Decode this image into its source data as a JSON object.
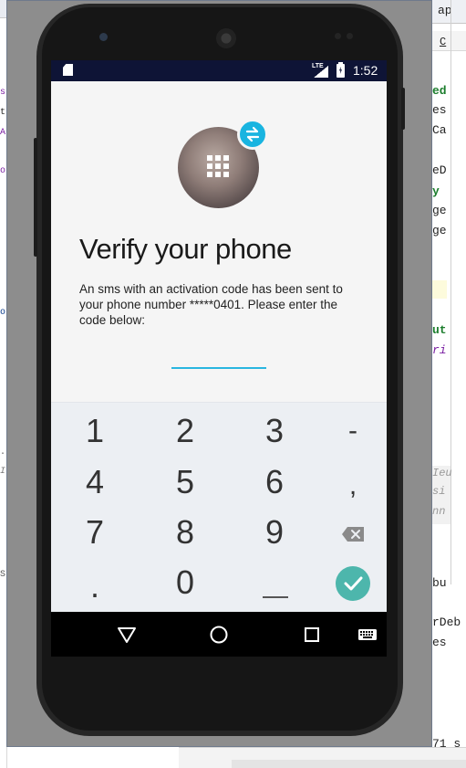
{
  "ide": {
    "left_code": [
      "s",
      "t",
      "A",
      "o",
      "o",
      ".",
      "I",
      "S"
    ],
    "right_top": "ap",
    "right_tab": "C",
    "right_code": [
      "ed",
      "es",
      "Ca",
      "eD",
      "y",
      "ge",
      "ge",
      "ut",
      "ri",
      "Ieu",
      "si",
      "nn",
      "bu",
      "rDeb",
      "es",
      "71 s"
    ]
  },
  "status_bar": {
    "network": "LTE",
    "time": "1:52"
  },
  "verify": {
    "title": "Verify your phone",
    "description_prefix": "An sms with an activation code has been sent to your phone number ",
    "phone_masked": "*****0401",
    "description_suffix": ". Please enter the code below:",
    "code_value": "",
    "code_placeholder": ""
  },
  "keypad": {
    "keys": [
      "1",
      "2",
      "3",
      "-",
      "4",
      "5",
      "6",
      ",",
      "7",
      "8",
      "9",
      ".",
      "0"
    ]
  },
  "colors": {
    "status_bar": "#0e1436",
    "accent": "#29b6e0",
    "confirm": "#4db6ac",
    "keypad_bg": "#eceff3"
  },
  "icons": {
    "sd_card": "sd-card-icon",
    "signal": "signal-icon",
    "battery": "battery-charging-icon",
    "swap": "swap-arrows-icon",
    "backspace": "backspace-icon",
    "confirm": "check-icon",
    "back": "back-triangle-icon",
    "home": "home-circle-icon",
    "recents": "recents-square-icon",
    "keyboard": "keyboard-icon"
  }
}
